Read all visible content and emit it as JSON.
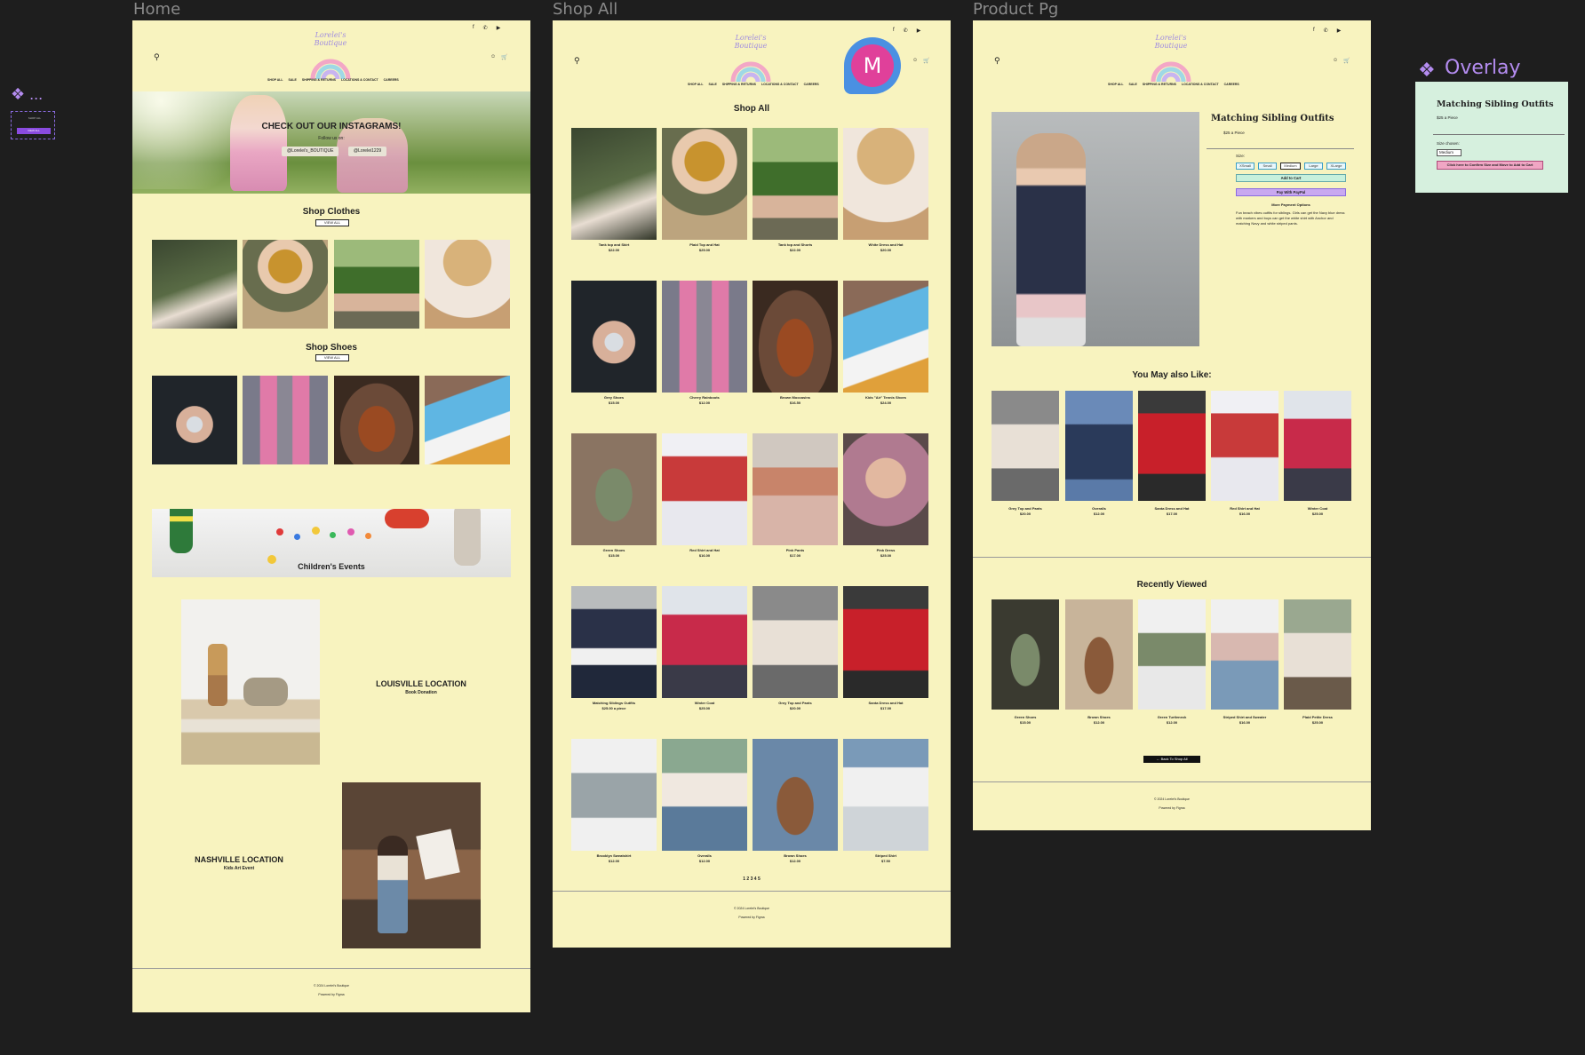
{
  "canvas": {
    "frame_labels": [
      "Home",
      "Shop All",
      "Product Pg",
      "Overlay"
    ],
    "component_mark": "❖ ...",
    "component_btn_top": "SHOP ALL",
    "component_btn_bottom": "VIEW ALL"
  },
  "brand": {
    "logo_text": "Lorelei's Boutique",
    "social_icons": [
      "f",
      "✆",
      "▶"
    ],
    "nav": [
      "SHOP ALL",
      "SALE",
      "SHIPPING & RETURNS",
      "LOCATIONS & CONTACT",
      "CAREERS"
    ]
  },
  "home": {
    "hero_title": "CHECK OUT OUR INSTAGRAMS!",
    "hero_sub": "Follow us on:",
    "hero_handles": [
      "@Lorelei's_BOUTIQUE",
      "@Lorelei1229"
    ],
    "shop_clothes": "Shop Clothes",
    "shop_shoes": "Shop Shoes",
    "view_all": "VIEW ALL",
    "events": "Children's Events",
    "louisville_title": "LOUISVILLE LOCATION",
    "louisville_sub": "Book Donation",
    "nashville_title": "NASHVILLE LOCATION",
    "nashville_sub": "Kids Art Event",
    "footer1": "© 2024 Lorelei's Boutique",
    "footer2": "Powered by Figma"
  },
  "shop": {
    "title": "Shop All",
    "items": [
      {
        "name": "Tank top and Skirt",
        "price": "$22.00"
      },
      {
        "name": "Plaid Top and Hat",
        "price": "$25.00"
      },
      {
        "name": "Tank top and Shorts",
        "price": "$22.00"
      },
      {
        "name": "White Dress and Hat",
        "price": "$20.00"
      },
      {
        "name": "Grey Shoes",
        "price": "$15.00"
      },
      {
        "name": "Cherry Rainboots",
        "price": "$12.00"
      },
      {
        "name": "Brown Moccasins",
        "price": "$16.50"
      },
      {
        "name": "Kids \"Air\" Tennis Shoes",
        "price": "$24.00"
      },
      {
        "name": "Green Shoes",
        "price": "$15.00"
      },
      {
        "name": "Red Shirt and Hat",
        "price": "$16.00"
      },
      {
        "name": "Pink Pants",
        "price": "$17.00"
      },
      {
        "name": "Pink Dress",
        "price": "$25.00"
      },
      {
        "name": "Matching Siblings Outfits",
        "price": "$25.00 a piece"
      },
      {
        "name": "Winter Coat",
        "price": "$25.00"
      },
      {
        "name": "Grey Top and Pants",
        "price": "$20.00"
      },
      {
        "name": "Santa Dress and Hat",
        "price": "$17.00"
      },
      {
        "name": "Brooklyn Sweatshirt",
        "price": "$12.00"
      },
      {
        "name": "Overalls",
        "price": "$12.00"
      },
      {
        "name": "Brown Shoes",
        "price": "$12.00"
      },
      {
        "name": "Striped Shirt",
        "price": "$7.50"
      }
    ],
    "pagination": "1 2 3 4 5",
    "footer1": "© 2024 Lorelei's Boutique",
    "footer2": "Powered by Figma"
  },
  "avatar_letter": "M",
  "product": {
    "title": "Matching Sibling Outfits",
    "price": "$25 a Piece",
    "size_label": "Size:",
    "sizes": [
      "XSmall",
      "Small",
      "Medium",
      "Large",
      "XLarge"
    ],
    "add_to_cart": "Add to Cart",
    "pay_paypal": "Pay With PayPal",
    "more_payment": "More Payment Options",
    "description": "Fun beach vibes outfits for siblings. Girls can get the Navy blue dress with markers and boys can get the white shirt with Anchor and matching Navy and white striped pants.",
    "you_may_like": "You May also Like:",
    "like_items": [
      {
        "name": "Grey Top and Pants",
        "price": "$20.00"
      },
      {
        "name": "Overalls",
        "price": "$12.00"
      },
      {
        "name": "Santa Dress and Hat",
        "price": "$17.00"
      },
      {
        "name": "Red Shirt and Hat",
        "price": "$16.00"
      },
      {
        "name": "Winter Coat",
        "price": "$25.00"
      }
    ],
    "recently_viewed": "Recently Viewed",
    "recent_items": [
      {
        "name": "Green Shoes",
        "price": "$15.00"
      },
      {
        "name": "Brown Shoes",
        "price": "$12.00"
      },
      {
        "name": "Green Turtleneck",
        "price": "$12.00"
      },
      {
        "name": "Striped Shirt and Sweater",
        "price": "$16.00"
      },
      {
        "name": "Plaid Petite Dress",
        "price": "$25.00"
      }
    ],
    "back_btn": "← Back To Shop All",
    "footer1": "© 2024 Lorelei's Boutique",
    "footer2": "Powered by Figma"
  },
  "overlay": {
    "title": "Matching Sibling Outfits",
    "price": "$25 a Piece",
    "size_chosen_label": "Size chosen:",
    "size_chosen": "Medium",
    "confirm_btn": "Click here to Confirm Size and Move to Add to Cart"
  }
}
